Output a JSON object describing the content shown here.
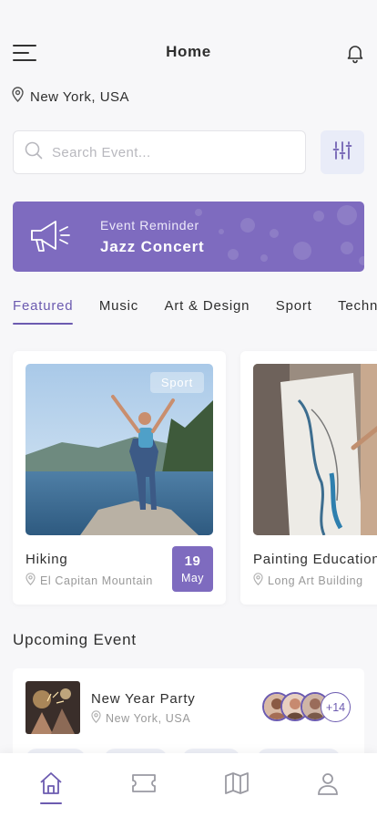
{
  "header": {
    "title": "Home"
  },
  "location": {
    "text": "New York, USA"
  },
  "search": {
    "placeholder": "Search Event..."
  },
  "reminder": {
    "label": "Event Reminder",
    "name": "Jazz Concert"
  },
  "tabs": [
    {
      "label": "Featured",
      "active": true
    },
    {
      "label": "Music",
      "active": false
    },
    {
      "label": "Art & Design",
      "active": false
    },
    {
      "label": "Sport",
      "active": false
    },
    {
      "label": "Technology",
      "active": false
    }
  ],
  "featured": [
    {
      "tag": "Sport",
      "title": "Hiking",
      "location": "El Capitan Mountain",
      "day": "19",
      "month": "May"
    },
    {
      "title": "Painting Education",
      "location": "Long Art Building"
    }
  ],
  "upcoming": {
    "section_title": "Upcoming Event",
    "event": {
      "title": "New Year Party",
      "location": "New York, USA",
      "extra_attendees": "+14"
    }
  },
  "bottom_nav": [
    {
      "icon": "home-icon",
      "active": true
    },
    {
      "icon": "ticket-icon",
      "active": false
    },
    {
      "icon": "map-icon",
      "active": false
    },
    {
      "icon": "profile-icon",
      "active": false
    }
  ],
  "colors": {
    "accent": "#7E6BBF",
    "accent_dark": "#6C5BB0",
    "background": "#F7F7F9"
  }
}
